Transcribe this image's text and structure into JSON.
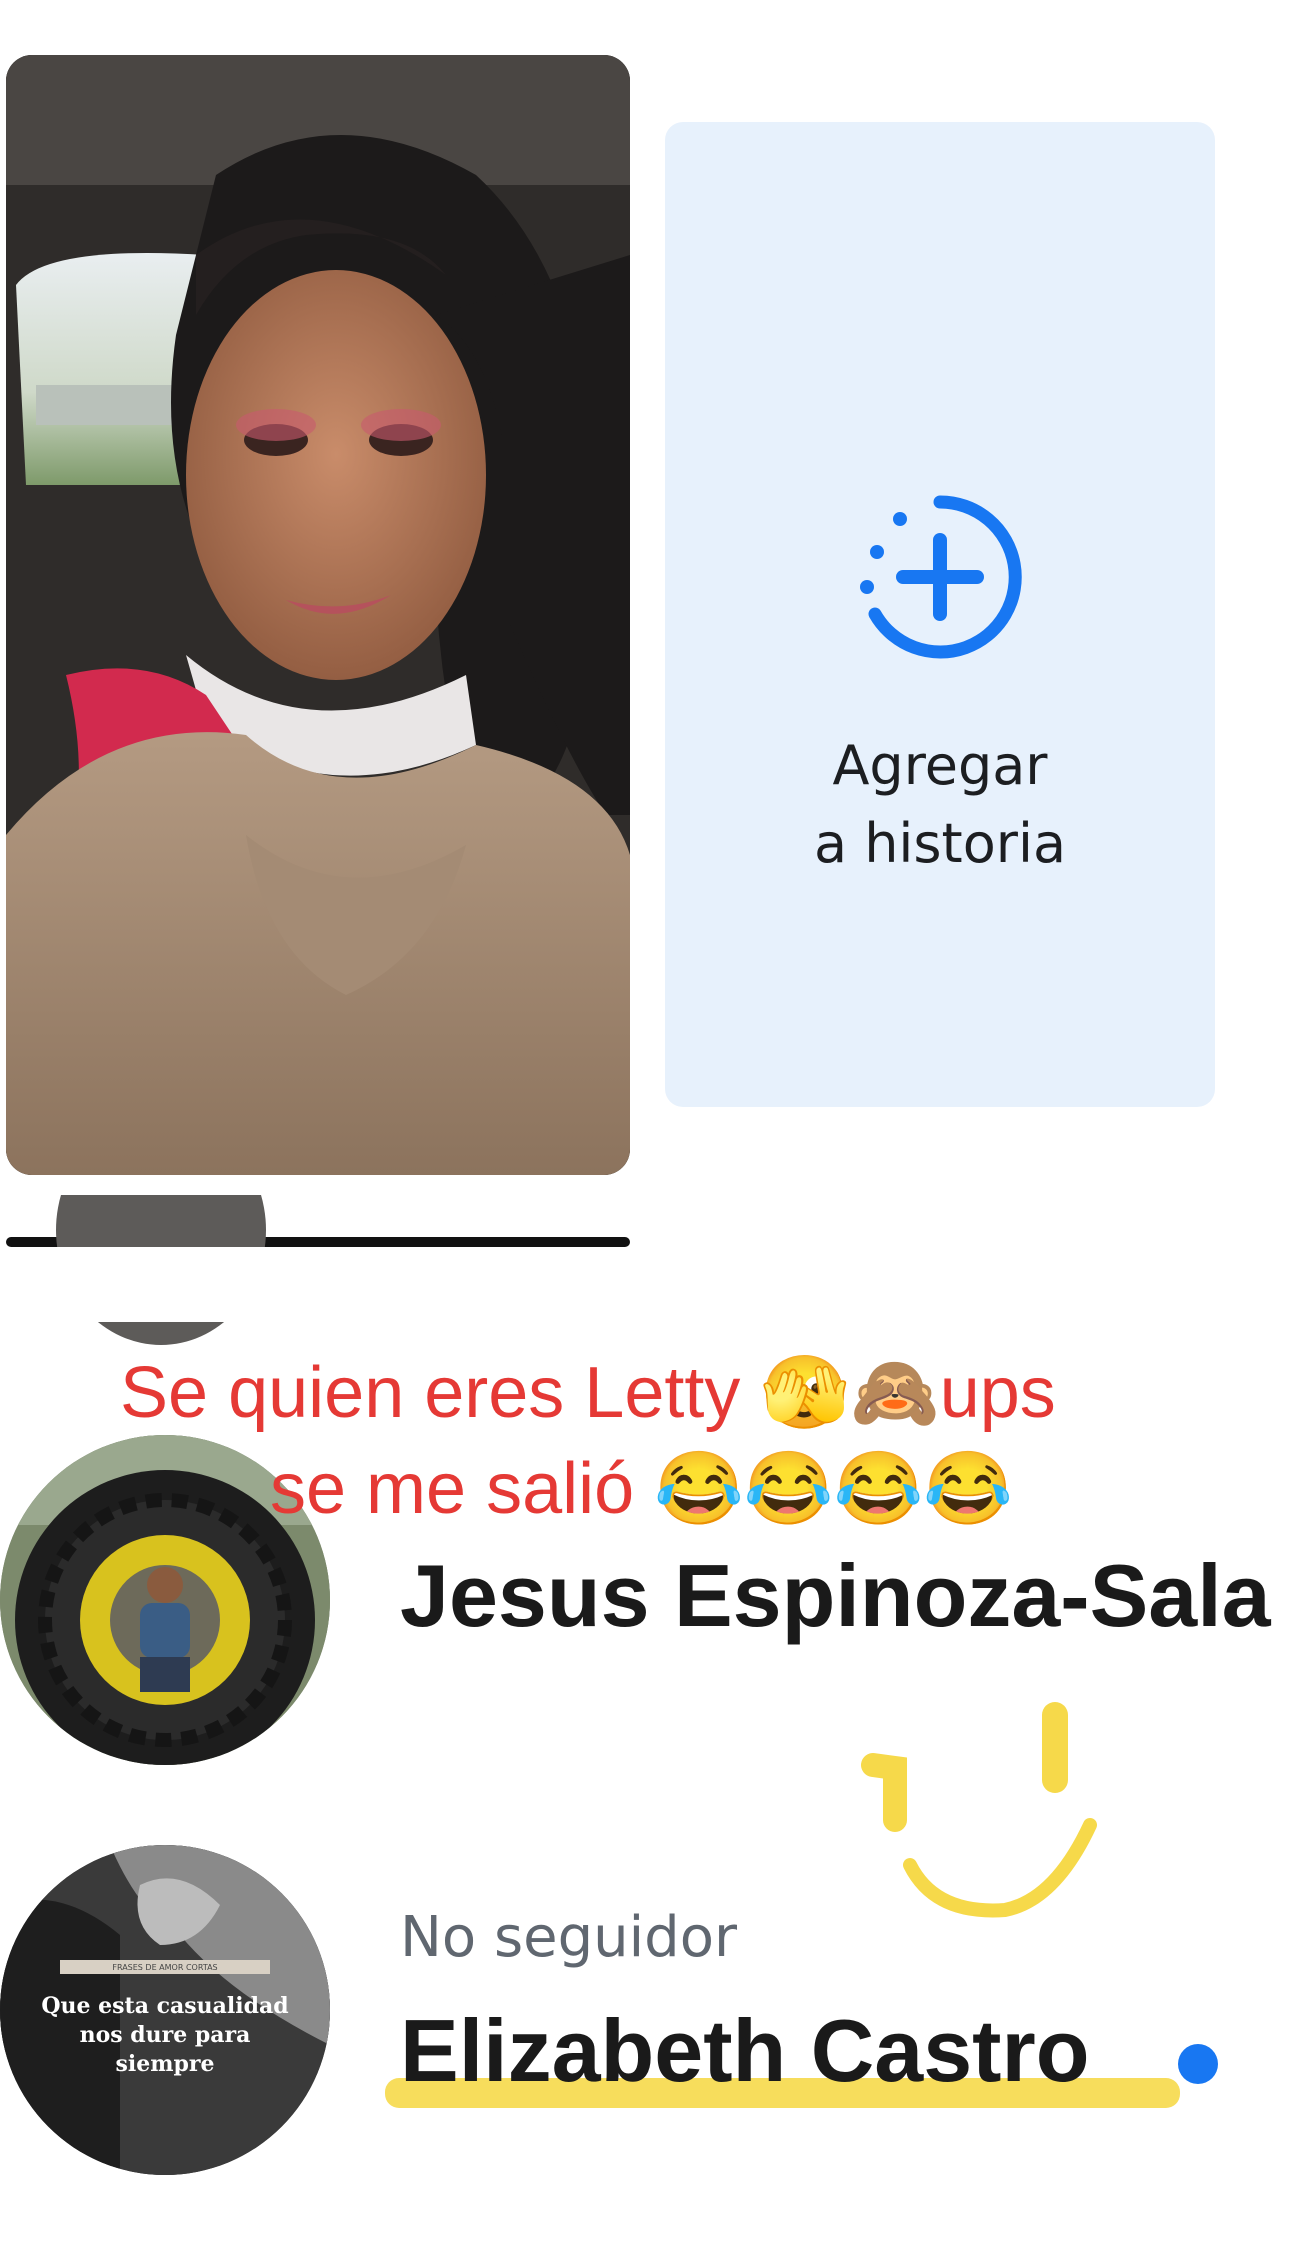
{
  "story": {
    "add_label_line1": "Agregar",
    "add_label_line2": "a historia"
  },
  "caption": {
    "line1": "Se quien eres  Letty 🫣🙈ups",
    "line2": "se me salió 😂😂😂😂"
  },
  "contacts": [
    {
      "name": "Jesus Espinoza-Sala",
      "subtitle": ""
    },
    {
      "name": "Elizabeth Castro",
      "subtitle": "No seguidor",
      "avatar_header": "FRASES DE AMOR CORTAS",
      "avatar_quote_lines": [
        "Que esta casualidad",
        "nos dure para",
        "siempre"
      ]
    }
  ],
  "colors": {
    "accent_blue": "#1877f2",
    "add_story_bg": "#e7f1fc",
    "caption_red": "#e53935",
    "highlight_yellow": "#f6d94a"
  },
  "icons": {
    "add_story": "add-circle-icon",
    "unread": "unread-dot-icon"
  }
}
